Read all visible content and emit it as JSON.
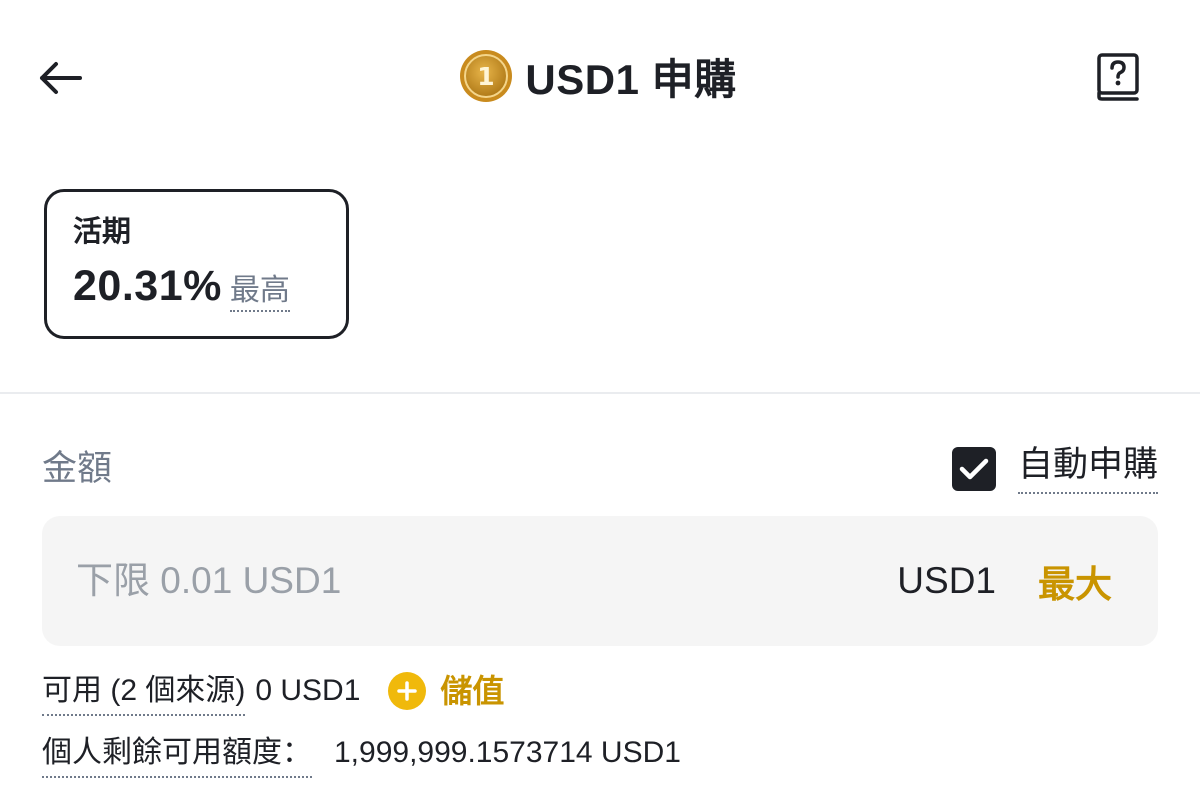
{
  "header": {
    "back_icon": "arrow-left-icon",
    "coin_icon": "usd1-coin-icon",
    "coin_glyph": "1",
    "title": "USD1 申購",
    "help_icon": "help-book-icon"
  },
  "product_card": {
    "type_label": "活期",
    "rate": "20.31%",
    "rate_note": "最高"
  },
  "amount": {
    "label": "金額",
    "auto_subscribe_label": "自動申購",
    "auto_subscribe_checked": true,
    "placeholder": "下限 0.01 USD1",
    "value": "",
    "unit": "USD1",
    "max_label": "最大"
  },
  "available": {
    "label": "可用 (2 個來源)",
    "value": "0 USD1",
    "deposit_label": "儲值",
    "deposit_icon": "plus-circle-icon"
  },
  "quota": {
    "label": "個人剩餘可用額度：",
    "value": "1,999,999.1573714 USD1"
  },
  "colors": {
    "text_primary": "#1e2026",
    "text_secondary": "#707a8a",
    "accent": "#c99400",
    "accent_fill": "#f0b90b",
    "input_bg": "#f5f5f5"
  }
}
